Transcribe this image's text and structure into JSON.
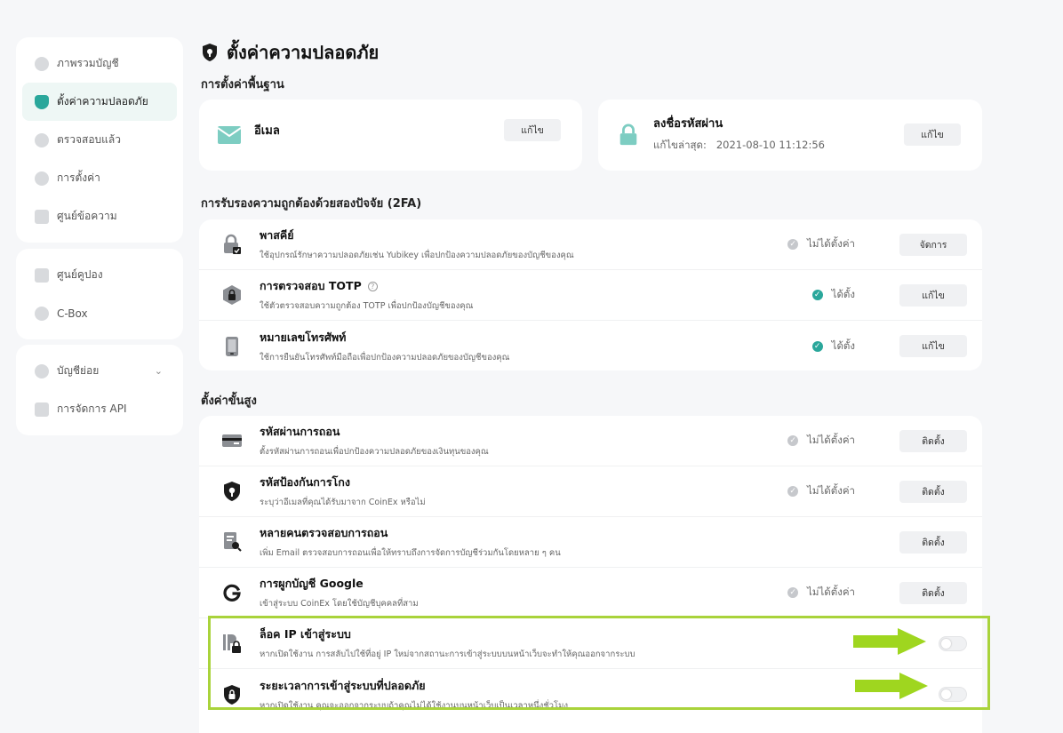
{
  "sidebar": {
    "group1": [
      {
        "label": "ภาพรวมบัญชี",
        "icon": "pie-chart-icon"
      },
      {
        "label": "ตั้งค่าความปลอดภัย",
        "icon": "shield-icon"
      },
      {
        "label": "ตรวจสอบแล้ว",
        "icon": "verified-badge-icon"
      },
      {
        "label": "การตั้งค่า",
        "icon": "gear-icon"
      },
      {
        "label": "ศูนย์ข้อความ",
        "icon": "message-icon"
      }
    ],
    "group2": [
      {
        "label": "ศูนย์คูปอง",
        "icon": "coupon-icon"
      },
      {
        "label": "C-Box",
        "icon": "box-icon"
      }
    ],
    "group3": [
      {
        "label": "บัญชีย่อย",
        "icon": "sub-account-icon"
      },
      {
        "label": "การจัดการ API",
        "icon": "api-icon"
      }
    ]
  },
  "page": {
    "title": "ตั้งค่าความปลอดภัย",
    "basic_heading": "การตั้งค่าพื้นฐาน",
    "twofa_heading": "การรับรองความถูกต้องด้วยสองปัจจัย (2FA)",
    "advanced_heading": "ตั้งค่าขั้นสูง"
  },
  "basic": {
    "email": {
      "title": "อีเมล",
      "button": "แก้ไข"
    },
    "password": {
      "title": "ลงชื่อรหัสผ่าน",
      "modified_label": "แก้ไขล่าสุด:",
      "modified_value": "2021-08-10 11:12:56",
      "button": "แก้ไข"
    }
  },
  "twofa": [
    {
      "title": "พาสคีย์",
      "desc": "ใช้อุปกรณ์รักษาความปลอดภัยเช่น Yubikey เพื่อปกป้องความปลอดภัยของบัญชีของคุณ",
      "status": "ไม่ได้ตั้งค่า",
      "button": "จัดการ"
    },
    {
      "title": "การตรวจสอบ TOTP",
      "help": "?",
      "desc": "ใช้ตัวตรวจสอบความถูกต้อง TOTP เพื่อปกป้องบัญชีของคุณ",
      "status": "ได้ตั้ง",
      "button": "แก้ไข"
    },
    {
      "title": "หมายเลขโทรศัพท์",
      "desc": "ใช้การยืนยันโทรศัพท์มือถือเพื่อปกป้องความปลอดภัยของบัญชีของคุณ",
      "status": "ได้ตั้ง",
      "button": "แก้ไข"
    }
  ],
  "advanced": [
    {
      "title": "รหัสผ่านการถอน",
      "desc": "ตั้งรหัสผ่านการถอนเพื่อปกป้องความปลอดภัยของเงินทุนของคุณ",
      "status": "ไม่ได้ตั้งค่า",
      "button": "ติดตั้ง"
    },
    {
      "title": "รหัสป้องกันการโกง",
      "desc": "ระบุว่าอีเมลที่คุณได้รับมาจาก CoinEx หรือไม่",
      "status": "ไม่ได้ตั้งค่า",
      "button": "ติดตั้ง"
    },
    {
      "title": "หลายคนตรวจสอบการถอน",
      "desc": "เพิ่ม Email ตรวจสอบการถอนเพื่อให้ทราบถึงการจัดการบัญชีร่วมกันโดยหลาย ๆ คน",
      "button": "ติดตั้ง"
    },
    {
      "title": "การผูกบัญชี Google",
      "desc": "เข้าสู่ระบบ CoinEx โดยใช้บัญชีบุคคลที่สาม",
      "status": "ไม่ได้ตั้งค่า",
      "button": "ติดตั้ง"
    },
    {
      "title": "ล็อค IP เข้าสู่ระบบ",
      "desc": "หากเปิดใช้งาน การสลับไปใช้ที่อยู่ IP ใหม่จากสถานะการเข้าสู่ระบบบนหน้าเว็บจะทำให้คุณออกจากระบบ",
      "toggle": false
    },
    {
      "title": "ระยะเวลาการเข้าสู่ระบบที่ปลอดภัย",
      "desc": "หากเปิดใช้งาน คุณจะออกจากระบบถ้าคุณไม่ได้ใช้งานบนหน้าเว็บเป็นเวลาหนึ่งชั่วโมง",
      "toggle": false
    }
  ],
  "colors": {
    "accent": "#2aa79b",
    "highlight": "#a9d33b",
    "arrow": "#9fd61f"
  }
}
